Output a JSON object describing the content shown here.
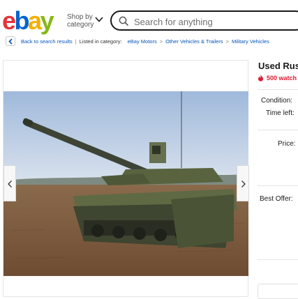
{
  "header": {
    "logo_letters": [
      "e",
      "b",
      "a",
      "y"
    ],
    "logo_colors": [
      "#e53238",
      "#0064d2",
      "#f5af02",
      "#86b817"
    ],
    "shop_by": "Shop by",
    "category": "category",
    "category_icon": "chevron-down-icon",
    "search_placeholder": "Search for anything",
    "search_icon": "search-icon"
  },
  "breadcrumb": {
    "back_icon": "chevron-left-icon",
    "back_label": "Back to search results",
    "listed_in": "Listed in category:",
    "items": [
      "eBay Motors",
      "Other Vehicles & Trailers",
      "Military Vehicles"
    ],
    "link_color": "#0654ba"
  },
  "gallery": {
    "prev_icon": "chevron-left-icon",
    "next_icon": "chevron-right-icon"
  },
  "listing": {
    "title": "Used Rus",
    "watchers": "500 watch",
    "watch_icon": "flame-icon",
    "watch_color": "#dd1e31",
    "condition_label": "Condition:",
    "time_left_label": "Time left:",
    "price_label": "Price:",
    "best_offer_label": "Best Offer:"
  }
}
